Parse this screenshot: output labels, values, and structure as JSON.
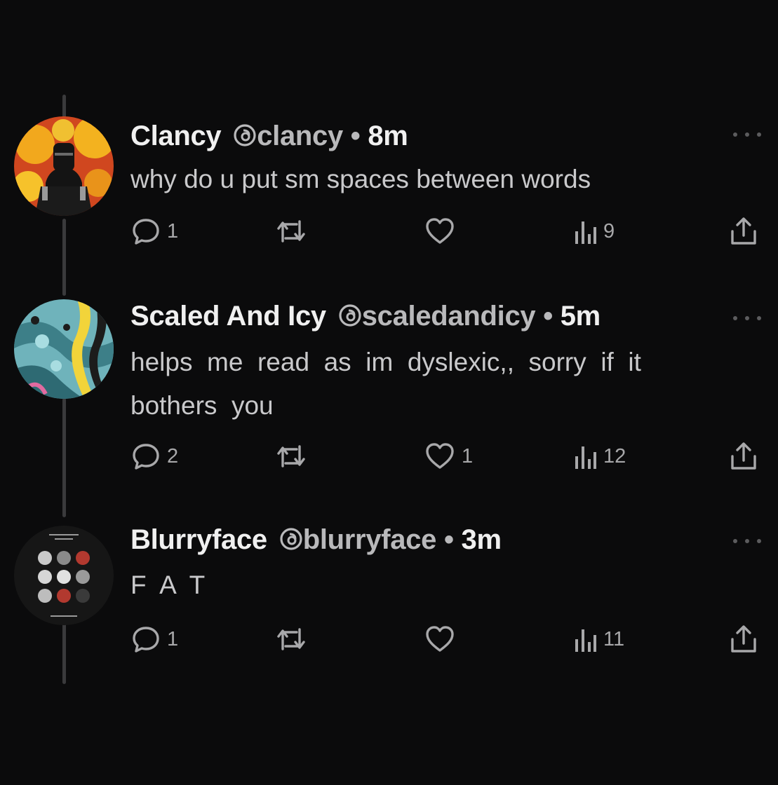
{
  "posts": [
    {
      "name": "Clancy",
      "handle": "clancy",
      "dot": "•",
      "time": "8m",
      "text": "why do u put sm spaces between words",
      "replies": "1",
      "reposts": "",
      "likes": "",
      "views": "9"
    },
    {
      "name": "Scaled And Icy",
      "handle": "scaledandicy",
      "dot": "•",
      "time": "5m",
      "text": "helps  me  read  as  im  dyslexic,,  sorry  if  it\nbothers  you",
      "replies": "2",
      "reposts": "",
      "likes": "1",
      "views": "12"
    },
    {
      "name": "Blurryface",
      "handle": "blurryface",
      "dot": "•",
      "time": "3m",
      "text": "F  A  T",
      "replies": "1",
      "reposts": "",
      "likes": "",
      "views": "11"
    }
  ],
  "icons": {
    "handle_mark": "threads-icon",
    "reply": "reply-icon",
    "repost": "repost-icon",
    "like": "heart-icon",
    "views": "views-icon",
    "share": "share-icon",
    "more": "more-icon"
  },
  "colors": {
    "background": "#0b0b0c",
    "name": "#f0f0f0",
    "handle": "#b9b9bb",
    "body": "#c9c9cb",
    "icon": "#a8a8aa",
    "thread_line": "#3a3a3c"
  }
}
